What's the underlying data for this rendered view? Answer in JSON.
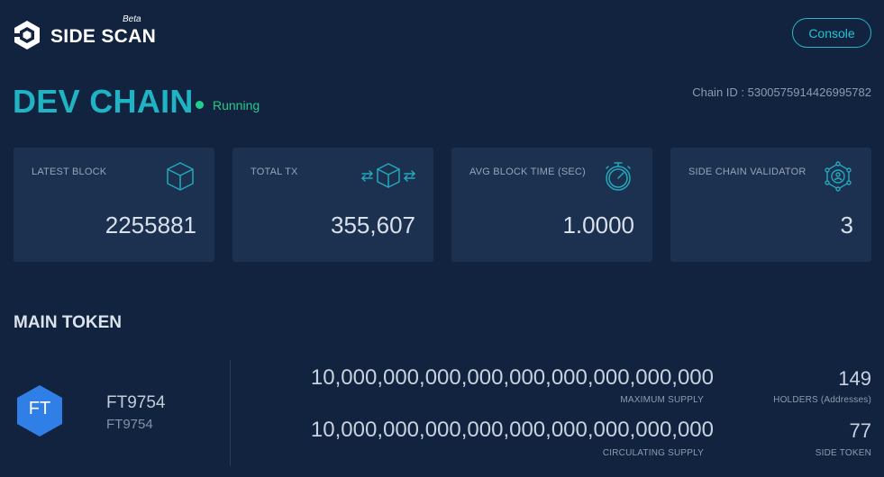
{
  "header": {
    "logo_text": "SIDE SCAN",
    "logo_badge": "Beta",
    "console_label": "Console"
  },
  "chain": {
    "name": "DEV CHAIN",
    "status": "Running",
    "status_color": "#1fcf8f",
    "chain_id": "Chain ID : 5300575914426995782"
  },
  "stats": [
    {
      "label": "LATEST BLOCK",
      "value": "2255881",
      "icon": "cube-icon"
    },
    {
      "label": "TOTAL TX",
      "value": "355,607",
      "icon": "transfer-cube-icon"
    },
    {
      "label": "AVG BLOCK TIME (SEC)",
      "value": "1.0000",
      "icon": "stopwatch-icon"
    },
    {
      "label": "SIDE CHAIN VALIDATOR",
      "value": "3",
      "icon": "validator-network-icon"
    }
  ],
  "main_token": {
    "section_title": "MAIN TOKEN",
    "logo_symbol": "FT",
    "name": "FT9754",
    "symbol": "FT9754",
    "max_supply": "10,000,000,000,000,000,000,000,000,000",
    "max_supply_label": "MAXIMUM SUPPLY",
    "circ_supply": "10,000,000,000,000,000,000,000,000,000",
    "circ_supply_label": "CIRCULATING SUPPLY",
    "holders": "149",
    "holders_label": "HOLDERS (Addresses)",
    "side_token": "77",
    "side_token_label": "SIDE TOKEN"
  },
  "colors": {
    "background": "#12233f",
    "card": "#1c3050",
    "accent": "#1fb3c3",
    "token_blue": "#2f7fe6"
  }
}
